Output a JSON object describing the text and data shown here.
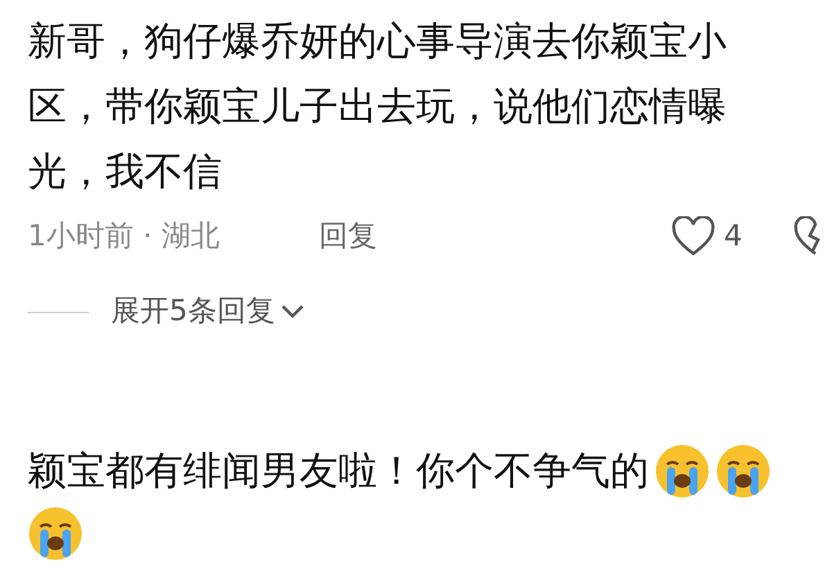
{
  "comments": [
    {
      "text_lines": [
        "新哥，狗仔爆乔妍的心事导演去你颖宝小",
        "区，带你颖宝儿子出去玩，说他们恋情曝",
        "光，我不信"
      ],
      "time": "1小时前 · 湖北",
      "reply": "回复",
      "likes": "4",
      "expand": "展开5条回复"
    },
    {
      "text_lines": [
        "颖宝都有绯闻男友啦！你个不争气的"
      ]
    }
  ]
}
